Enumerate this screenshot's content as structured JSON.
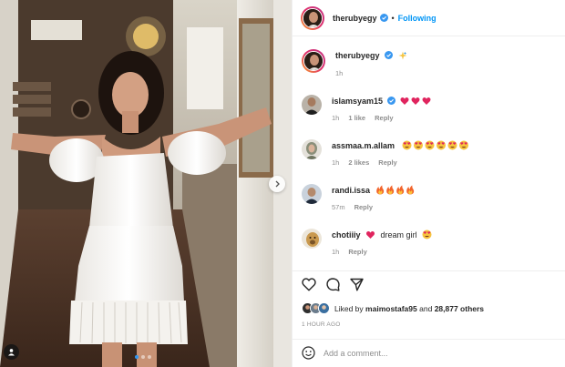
{
  "post": {
    "author": "therubyegy",
    "follow_label": "Following",
    "separator": "•",
    "caption_time": "1h",
    "carousel": {
      "slides": 3,
      "active_index": 0
    }
  },
  "comments": [
    {
      "user": "islamsyam15",
      "verified": true,
      "emojis": [
        "red-heart",
        "red-heart",
        "red-heart"
      ],
      "time": "1h",
      "likes": "1 like",
      "reply": "Reply"
    },
    {
      "user": "assmaa.m.allam",
      "verified": false,
      "emojis": [
        "heart-eyes",
        "heart-eyes",
        "heart-eyes",
        "heart-eyes",
        "heart-eyes",
        "heart-eyes"
      ],
      "time": "1h",
      "likes": "2 likes",
      "reply": "Reply"
    },
    {
      "user": "randi.issa",
      "verified": false,
      "emojis": [
        "fire",
        "fire",
        "fire",
        "fire"
      ],
      "time": "57m",
      "likes": "",
      "reply": "Reply"
    },
    {
      "user": "chotiiiy",
      "verified": false,
      "text": "dream girl",
      "emojis_before": [
        "red-heart"
      ],
      "emojis_after": [
        "heart-eyes"
      ],
      "time": "1h",
      "likes": "",
      "reply": "Reply"
    }
  ],
  "likes": {
    "prefix": "Liked by",
    "user": "maimostafa95",
    "conjunction": "and",
    "others": "28,877 others"
  },
  "time_ago": "1 HOUR AGO",
  "comment_box": {
    "placeholder": "Add a comment..."
  },
  "icons": {
    "caption": "sparkles-icon",
    "like": "heart-outline-icon",
    "comment": "comment-bubble-icon",
    "share": "paper-plane-icon",
    "emoji": "smiley-icon",
    "next": "chevron-right-icon",
    "tags": "user-tag-icon"
  },
  "colors": {
    "link_blue": "#0095f6",
    "verified_blue": "#3897f0",
    "muted": "#8e8e8e",
    "text": "#262626",
    "heart_red": "#e0245e"
  }
}
